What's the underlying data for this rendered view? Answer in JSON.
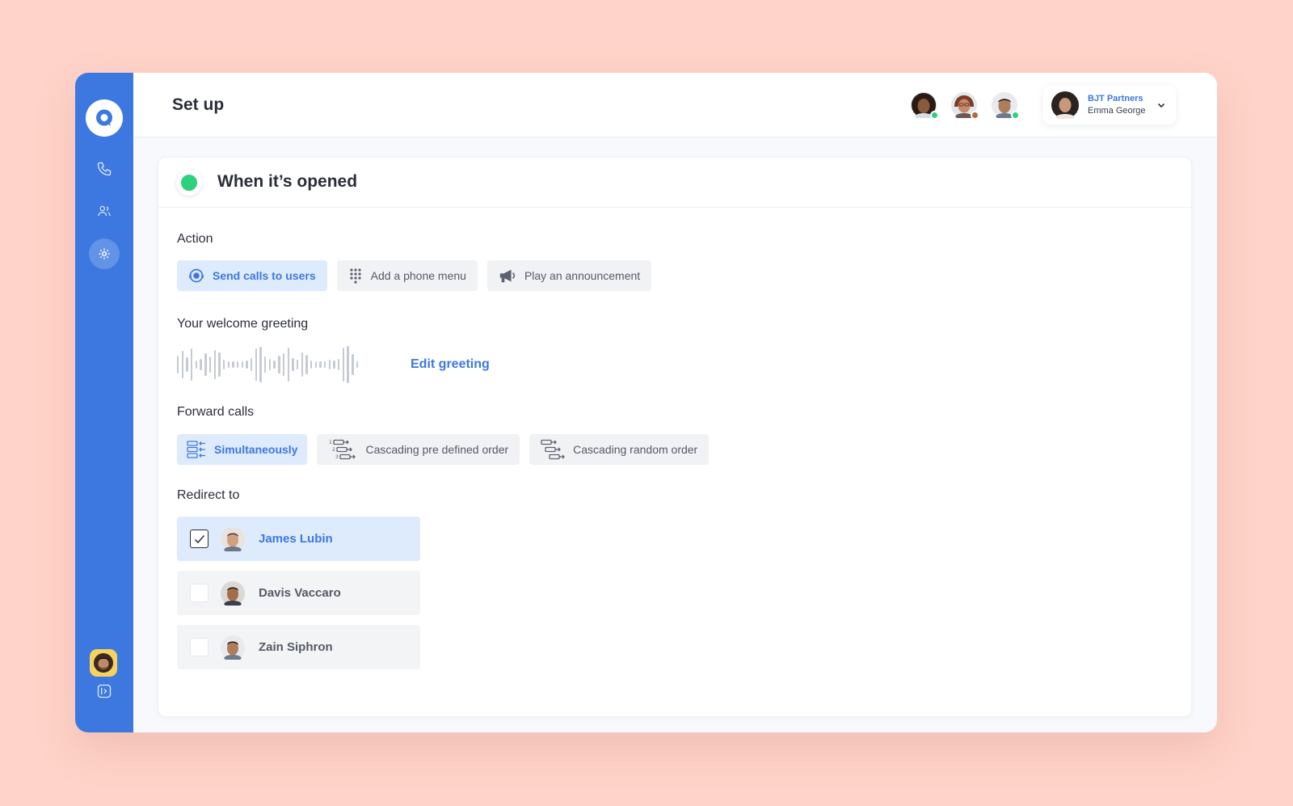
{
  "sidebar": {
    "logo_icon": "chat-bubble-icon",
    "nav": [
      {
        "icon": "phone-icon",
        "active": false
      },
      {
        "icon": "users-icon",
        "active": false
      },
      {
        "icon": "gear-icon",
        "active": true
      }
    ],
    "bottom_icon": "collapse-sidebar-icon"
  },
  "header": {
    "title": "Set up",
    "team_members": [
      {
        "status_color": "#2dd07d",
        "skin": "#8a5a3c",
        "hair": "#2a1a14"
      },
      {
        "status_color": "#b8663d",
        "skin": "#c8896a",
        "hair": "#7a3a24"
      },
      {
        "status_color": "#2dd07d",
        "skin": "#b07d5a",
        "hair": "#1c1c1c"
      }
    ],
    "account": {
      "company": "BJT Partners",
      "user": "Emma George"
    }
  },
  "card": {
    "title": "When it’s opened",
    "status_color": "#2dd07d",
    "action": {
      "label": "Action",
      "options": [
        {
          "label": "Send calls to users",
          "icon": "user-support-icon",
          "selected": true
        },
        {
          "label": "Add a phone menu",
          "icon": "keypad-icon",
          "selected": false
        },
        {
          "label": "Play an announcement",
          "icon": "megaphone-icon",
          "selected": false
        }
      ]
    },
    "greeting": {
      "label": "Your welcome greeting",
      "edit_label": "Edit greeting"
    },
    "forward": {
      "label": "Forward calls",
      "options": [
        {
          "label": "Simultaneously",
          "icon": "simultaneous-icon",
          "selected": true
        },
        {
          "label": "Cascading pre defined order",
          "icon": "cascade-ordered-icon",
          "selected": false
        },
        {
          "label": "Cascading random order",
          "icon": "cascade-random-icon",
          "selected": false
        }
      ]
    },
    "redirect": {
      "label": "Redirect to",
      "users": [
        {
          "name": "James Lubin",
          "checked": true
        },
        {
          "name": "Davis Vaccaro",
          "checked": false
        },
        {
          "name": "Zain Siphron",
          "checked": false
        }
      ]
    }
  },
  "colors": {
    "accent": "#3d78e0",
    "background": "#ffd3c9",
    "online": "#2dd07d"
  }
}
